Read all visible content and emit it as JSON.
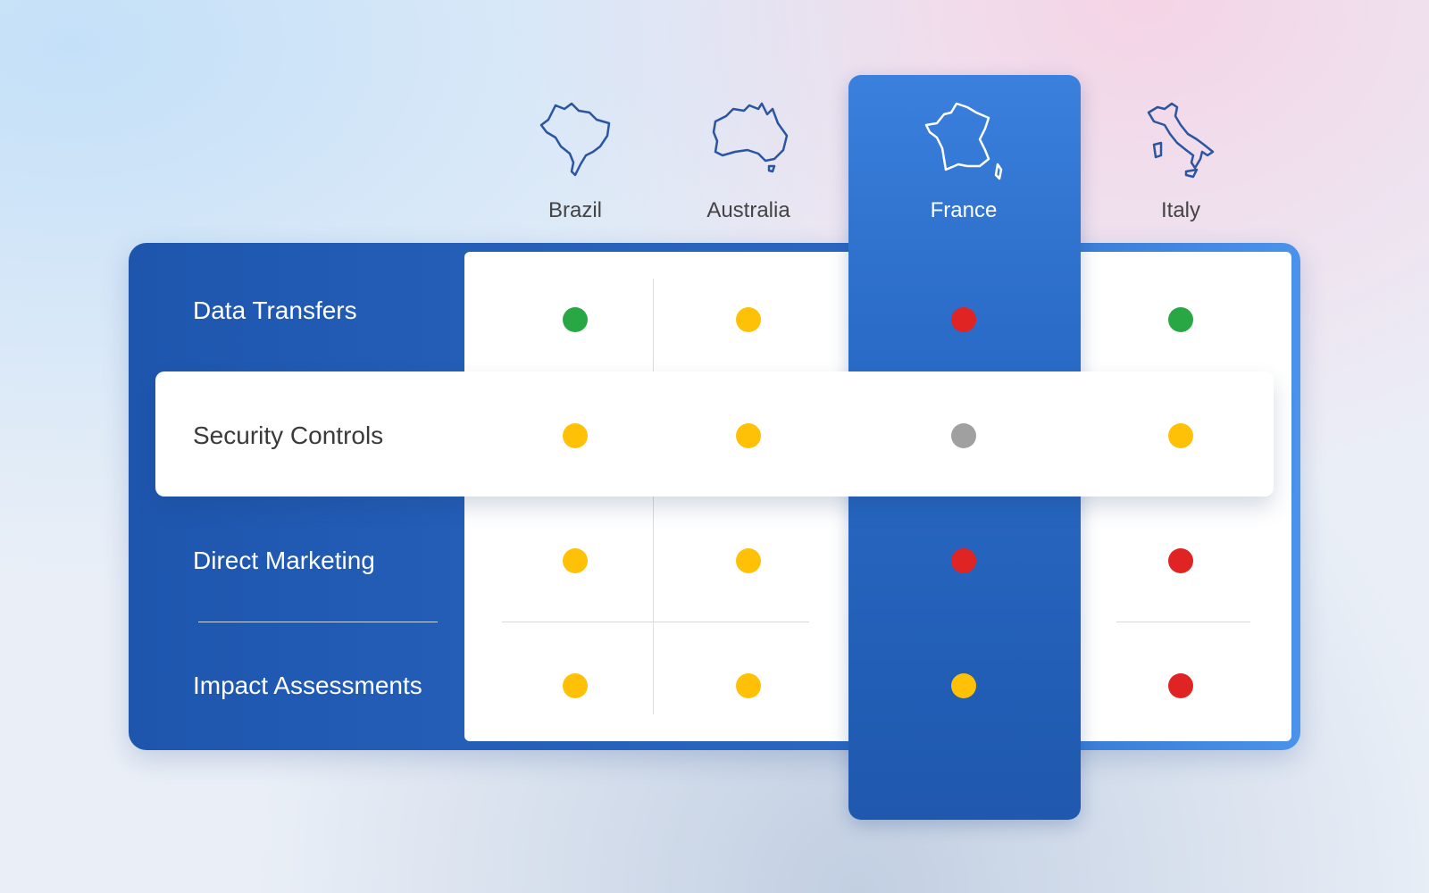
{
  "countries": [
    {
      "name": "Brazil",
      "icon": "brazil-map-icon"
    },
    {
      "name": "Australia",
      "icon": "australia-map-icon"
    },
    {
      "name": "France",
      "icon": "france-map-icon",
      "selected": true
    },
    {
      "name": "Italy",
      "icon": "italy-map-icon"
    }
  ],
  "rows": [
    {
      "label": "Data Transfers",
      "status": [
        "green",
        "yellow",
        "red",
        "green"
      ]
    },
    {
      "label": "Security Controls",
      "highlighted": true,
      "status": [
        "yellow",
        "yellow",
        "gray",
        "yellow"
      ]
    },
    {
      "label": "Direct Marketing",
      "status": [
        "yellow",
        "yellow",
        "red",
        "red"
      ]
    },
    {
      "label": "Impact Assessments",
      "status": [
        "yellow",
        "yellow",
        "yellow",
        "red"
      ]
    }
  ],
  "colors": {
    "green": "#29a745",
    "yellow": "#ffc107",
    "red": "#e02424",
    "gray": "#a0a0a0",
    "brand": "#2160b8"
  }
}
